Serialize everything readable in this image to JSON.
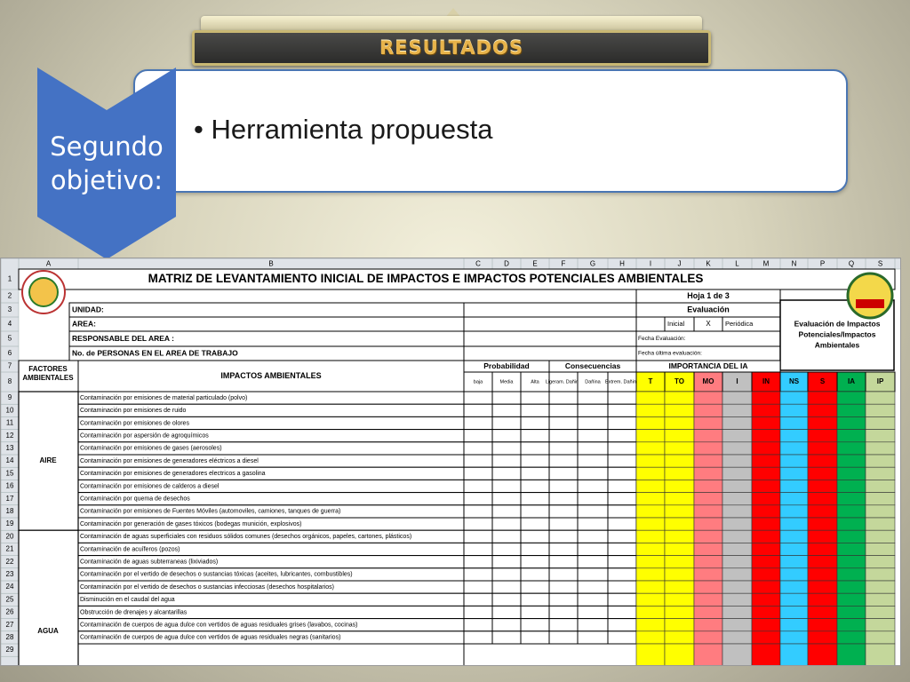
{
  "slide": {
    "banner_title": "RESULTADOS",
    "chevron_label_line1": "Segundo",
    "chevron_label_line2": "objetivo:",
    "bullet": "• Herramienta propuesta",
    "colors": {
      "chevron": "#4472c4",
      "box_border": "#4a76b3",
      "banner_text": "#e8b34a"
    }
  },
  "sheet": {
    "column_letters": [
      "A",
      "B",
      "C",
      "D",
      "E",
      "F",
      "G",
      "H",
      "I",
      "J",
      "K",
      "L",
      "M",
      "N",
      "P",
      "Q",
      "S"
    ],
    "row_numbers": [
      "1",
      "2",
      "3",
      "4",
      "5",
      "6",
      "7",
      "8",
      "9",
      "10",
      "11",
      "12",
      "13",
      "14",
      "15",
      "16",
      "17",
      "18",
      "19",
      "20",
      "21",
      "22",
      "23",
      "24",
      "25",
      "26",
      "27",
      "28",
      "29"
    ],
    "title": "MATRIZ DE LEVANTAMIENTO INICIAL DE IMPACTOS E IMPACTOS POTENCIALES AMBIENTALES",
    "page": "Hoja 1 de 3",
    "unidad": "UNIDAD:",
    "area": "AREA:",
    "responsable": "RESPONSABLE DEL AREA :",
    "personas": "No. de PERSONAS EN EL AREA DE TRABAJO",
    "evaluacion": "Evaluación",
    "inicial": "Inicial",
    "x_mark": "X",
    "periodica": "Periódica",
    "fecha_eval": "Fecha Evaluación:",
    "fecha_ultima": "Fecha última evaluación:",
    "side_box": [
      "Evaluación de Impactos",
      "Potenciales/Impactos",
      "Ambientales"
    ],
    "factores": [
      "FACTORES",
      "AMBIENTALES"
    ],
    "impactos_header": "IMPACTOS AMBIENTALES",
    "probabilidad": "Probabilidad",
    "consecuencias": "Consecuencias",
    "importancia": "IMPORTANCIA DEL IA",
    "sub_headers": [
      "baja",
      "Media",
      "Alta",
      "Ligeram. Dañina",
      "Dañina",
      "Extrem. Dañina"
    ],
    "importance_cols": [
      {
        "label": "T",
        "color": "#ffff00"
      },
      {
        "label": "TO",
        "color": "#ffff00"
      },
      {
        "label": "MO",
        "color": "#ff7c80"
      },
      {
        "label": "I",
        "color": "#c0c0c0"
      },
      {
        "label": "IN",
        "color": "#ff0000"
      },
      {
        "label": "NS",
        "color": "#33ccff"
      },
      {
        "label": "S",
        "color": "#ff0000"
      },
      {
        "label": "IA",
        "color": "#00b050"
      },
      {
        "label": "IP",
        "color": "#c4d79b"
      }
    ],
    "groups": [
      {
        "label": "AIRE"
      },
      {
        "label": "AGUA"
      }
    ],
    "impacts": [
      "Contaminación por emisiones de material particulado (polvo)",
      "Contaminación por emisiones de ruido",
      "Contaminación por emisiones de olores",
      "Contaminación por aspersión de agroquímicos",
      "Contaminación por emisiones de gases (aerosoles)",
      "Contaminación por emisiones de generadores eléctricos a diesel",
      "Contaminación por emisiones de generadores electricos a gasolina",
      "Contaminación por emisiones de calderos a diesel",
      "Contaminación por quema  de desechos",
      "Contaminación por emisiones de Fuentes Móviles (automoviles, camiones, tanques de guerra)",
      "Contaminación por generación de gases tóxicos (bodegas munición, explosivos)",
      "Contaminación de aguas superficiales con residuos sólidos comunes (desechos orgánicos, papeles, cartones, plásticos)",
      "Contaminación de acuíferos (pozos)",
      "Contaminación de aguas subterraneas (lixiviados)",
      "Contaminación por el vertido de desechos o sustancias tóxicas (aceites, lubricantes, combustibles)",
      "Contaminación por el vertido de desechos o sustancias infecciosas (desechos hospitalarios)",
      "Disminución en el caudal del agua",
      "Obstrucción de drenajes y alcantarillas",
      "Contaminación de cuerpos de agua dulce con vertidos de aguas residuales grises (lavabos, cocinas)",
      "Contaminación de cuerpos de agua dulce con vertidos de aguas residuales negras (sanitarios)"
    ]
  }
}
